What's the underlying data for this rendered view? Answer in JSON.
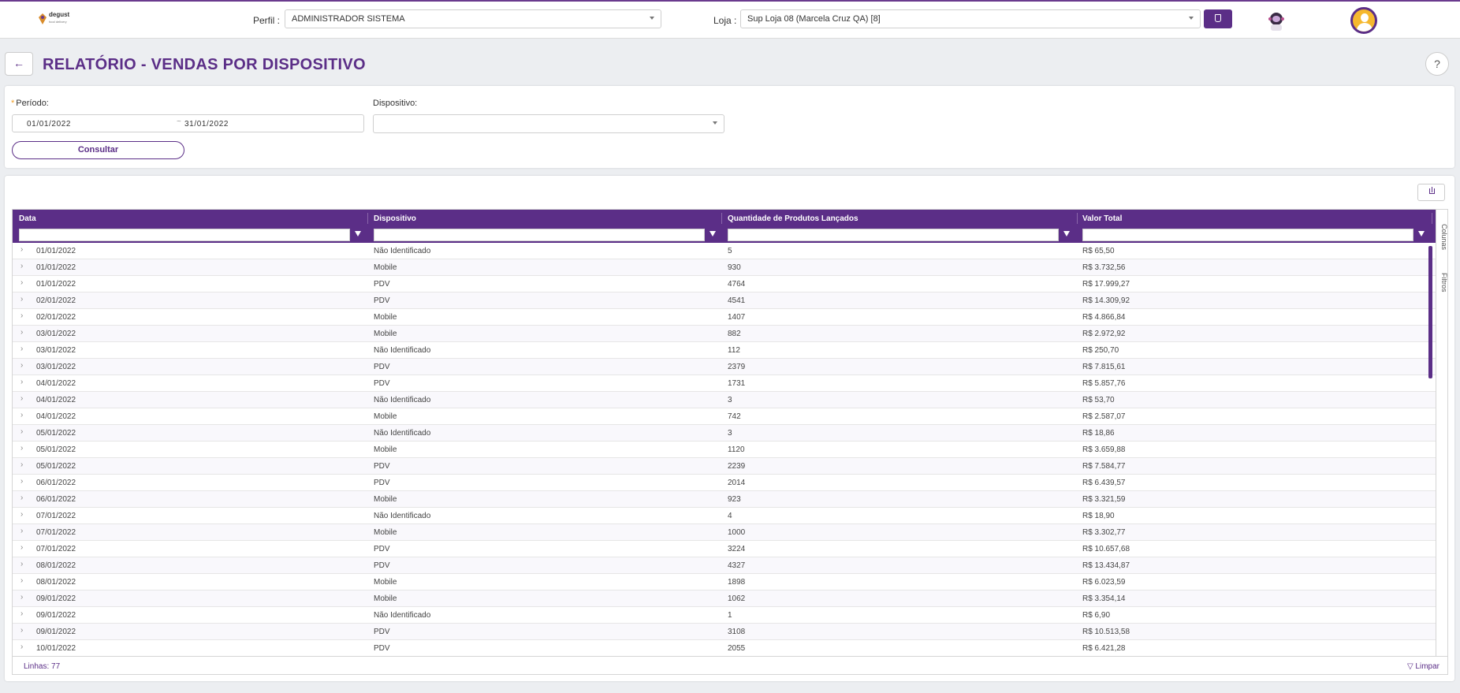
{
  "topbar": {
    "logo_name": "degust",
    "logo_sub": "food delivery",
    "profile_label": "Perfil :",
    "profile_value": "ADMINISTRADOR SISTEMA",
    "store_label": "Loja :",
    "store_value": "Sup Loja 08 (Marcela Cruz QA) [8]"
  },
  "page": {
    "back_icon": "←",
    "title": "RELATÓRIO - VENDAS POR DISPOSITIVO",
    "help_icon": "?"
  },
  "filters": {
    "period_label": "Período:",
    "period_required_mark": "*",
    "date_start": "01/01/2022",
    "date_sep": "~",
    "date_end": "31/01/2022",
    "device_label": "Dispositivo:",
    "device_value": "",
    "consult_button": "Consultar"
  },
  "grid": {
    "columns": [
      "Data",
      "Dispositivo",
      "Quantidade de Produtos Lançados",
      "Valor Total"
    ],
    "side_tabs": {
      "columns": "Colunas",
      "filters": "Filtros"
    },
    "rows": [
      [
        "01/01/2022",
        "Não Identificado",
        "5",
        "R$ 65,50"
      ],
      [
        "01/01/2022",
        "Mobile",
        "930",
        "R$ 3.732,56"
      ],
      [
        "01/01/2022",
        "PDV",
        "4764",
        "R$ 17.999,27"
      ],
      [
        "02/01/2022",
        "PDV",
        "4541",
        "R$ 14.309,92"
      ],
      [
        "02/01/2022",
        "Mobile",
        "1407",
        "R$ 4.866,84"
      ],
      [
        "03/01/2022",
        "Mobile",
        "882",
        "R$ 2.972,92"
      ],
      [
        "03/01/2022",
        "Não Identificado",
        "112",
        "R$ 250,70"
      ],
      [
        "03/01/2022",
        "PDV",
        "2379",
        "R$ 7.815,61"
      ],
      [
        "04/01/2022",
        "PDV",
        "1731",
        "R$ 5.857,76"
      ],
      [
        "04/01/2022",
        "Não Identificado",
        "3",
        "R$ 53,70"
      ],
      [
        "04/01/2022",
        "Mobile",
        "742",
        "R$ 2.587,07"
      ],
      [
        "05/01/2022",
        "Não Identificado",
        "3",
        "R$ 18,86"
      ],
      [
        "05/01/2022",
        "Mobile",
        "1120",
        "R$ 3.659,88"
      ],
      [
        "05/01/2022",
        "PDV",
        "2239",
        "R$ 7.584,77"
      ],
      [
        "06/01/2022",
        "PDV",
        "2014",
        "R$ 6.439,57"
      ],
      [
        "06/01/2022",
        "Mobile",
        "923",
        "R$ 3.321,59"
      ],
      [
        "07/01/2022",
        "Não Identificado",
        "4",
        "R$ 18,90"
      ],
      [
        "07/01/2022",
        "Mobile",
        "1000",
        "R$ 3.302,77"
      ],
      [
        "07/01/2022",
        "PDV",
        "3224",
        "R$ 10.657,68"
      ],
      [
        "08/01/2022",
        "PDV",
        "4327",
        "R$ 13.434,87"
      ],
      [
        "08/01/2022",
        "Mobile",
        "1898",
        "R$ 6.023,59"
      ],
      [
        "09/01/2022",
        "Mobile",
        "1062",
        "R$ 3.354,14"
      ],
      [
        "09/01/2022",
        "Não Identificado",
        "1",
        "R$ 6,90"
      ],
      [
        "09/01/2022",
        "PDV",
        "3108",
        "R$ 10.513,58"
      ],
      [
        "10/01/2022",
        "PDV",
        "2055",
        "R$ 6.421,28"
      ]
    ],
    "footer_lines": "Linhas: 77",
    "footer_clear": "Limpar"
  },
  "colors": {
    "primary": "#5b2e87",
    "accent": "#f5b82e"
  }
}
